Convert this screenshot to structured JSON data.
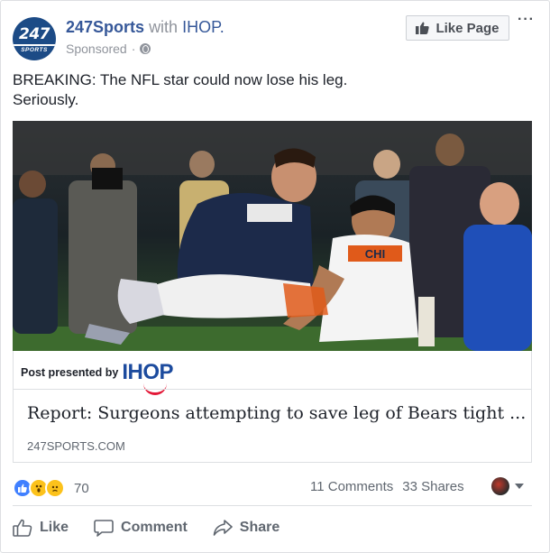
{
  "post": {
    "page_name": "247Sports",
    "with_text": "with",
    "partner_name": "IHOP.",
    "sponsored_label": "Sponsored",
    "meta_separator": "·",
    "avatar_number": "247",
    "avatar_sub": "SPORTS",
    "like_page_label": "Like Page",
    "more_label": "···",
    "text_lines": [
      "BREAKING: The NFL star could now lose his leg.",
      "Seriously."
    ]
  },
  "attachment": {
    "presented_label": "Post presented by",
    "sponsor_logo": "IHOP",
    "title": "Report: Surgeons attempting to save leg of Bears tight ...",
    "domain": "247SPORTS.COM",
    "jersey_text": "CHI"
  },
  "engagement": {
    "reaction_count": "70",
    "reactions": [
      "like",
      "wow",
      "sad"
    ],
    "comments": "11 Comments",
    "shares": "33 Shares"
  },
  "actions": {
    "like": "Like",
    "comment": "Comment",
    "share": "Share"
  },
  "colors": {
    "link_blue": "#365899",
    "meta_gray": "#90949c",
    "ihop_blue": "#1c4b9e",
    "ihop_red": "#e31837"
  },
  "icons": {
    "like_page": "thumbs-up-icon",
    "audience": "globe-icon",
    "like_action": "thumbs-up-outline-icon",
    "comment_action": "speech-bubble-icon",
    "share_action": "share-arrow-icon"
  }
}
